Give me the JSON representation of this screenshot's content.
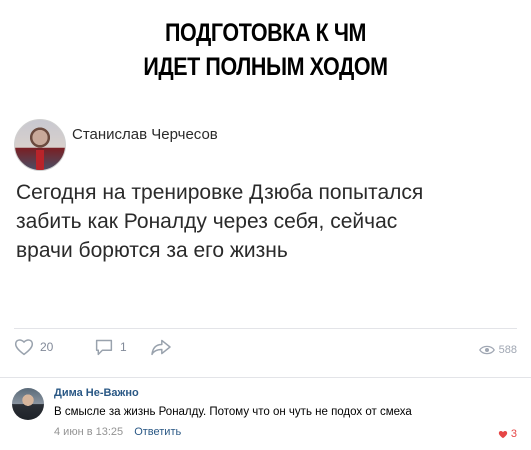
{
  "headline": {
    "line1": "ПОДГОТОВКА К ЧМ",
    "line2": "ИДЕТ ПОЛНЫМ ХОДОМ"
  },
  "post": {
    "author": "Станислав Черчесов",
    "text_line1": "Сегодня на тренировке Дзюба попытался",
    "text_line2": "забить как Роналду через себя, сейчас",
    "text_line3": "врачи борются за его жизнь",
    "likes": "20",
    "comments": "1",
    "views": "588",
    "icons": [
      "heart-icon",
      "comment-icon",
      "share-icon",
      "eye-icon"
    ]
  },
  "comment": {
    "author": "Дима Не-Важно",
    "text": "В смысле за жизнь Роналду. Потому что он чуть не подох от смеха",
    "time": "4 июн в 13:25",
    "reply_label": "Ответить",
    "likes": "3",
    "colors": {
      "link": "#2a5885",
      "like": "#e64646",
      "meta": "#939393"
    }
  }
}
